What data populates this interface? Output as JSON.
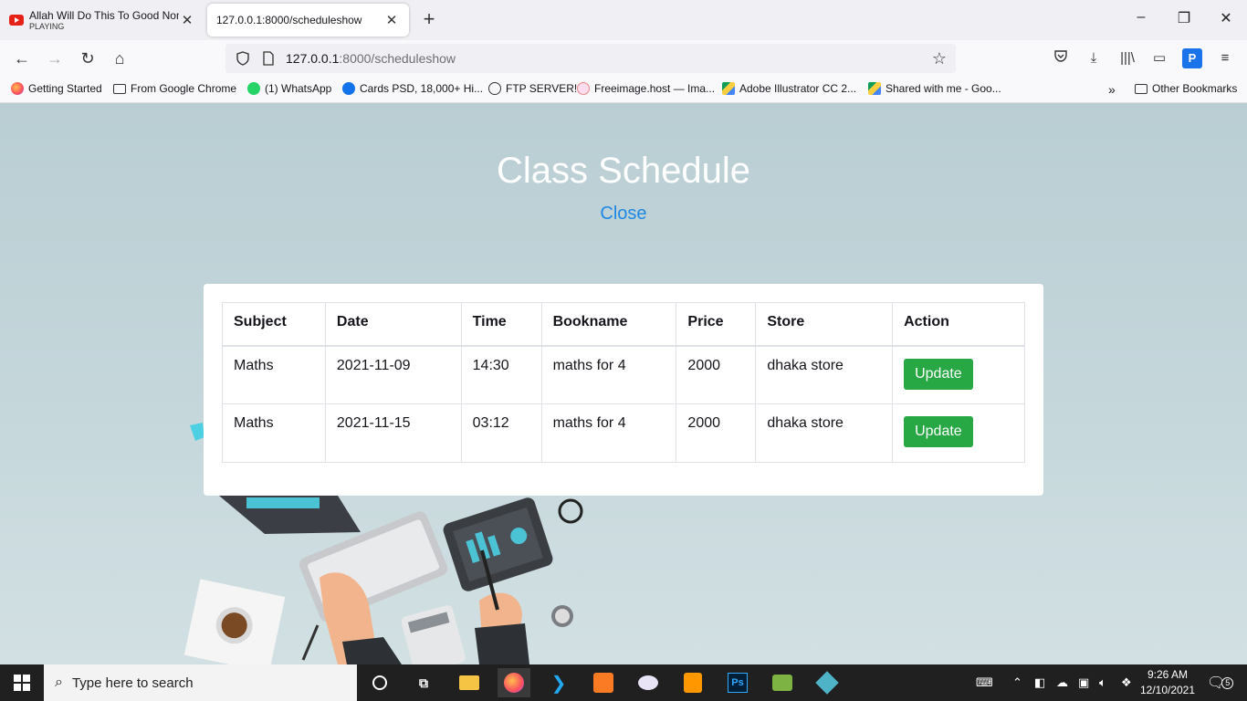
{
  "browser": {
    "tabs": [
      {
        "title": "Allah Will Do This To Good Non",
        "subtitle": "PLAYING",
        "active": false
      },
      {
        "title": "127.0.0.1:8000/scheduleshow",
        "active": true
      }
    ],
    "url_host": "127.0.0.1",
    "url_rest": ":8000/scheduleshow",
    "bookmarks": [
      {
        "label": "Getting Started",
        "icon": "firefox-icon"
      },
      {
        "label": "From Google Chrome",
        "icon": "folder-icon"
      },
      {
        "label": "(1) WhatsApp",
        "icon": "whatsapp-icon"
      },
      {
        "label": "Cards PSD, 18,000+ Hi...",
        "icon": "freepik-icon"
      },
      {
        "label": "FTP SERVER!",
        "icon": "globe-icon"
      },
      {
        "label": "Freeimage.host — Ima...",
        "icon": "freeimage-icon"
      },
      {
        "label": "Adobe Illustrator CC 2...",
        "icon": "google-drive-icon"
      },
      {
        "label": "Shared with me - Goo...",
        "icon": "google-drive-icon"
      }
    ],
    "other_bookmarks": "Other Bookmarks"
  },
  "page": {
    "title": "Class Schedule",
    "close_label": "Close",
    "table": {
      "headers": [
        "Subject",
        "Date",
        "Time",
        "Bookname",
        "Price",
        "Store",
        "Action"
      ],
      "rows": [
        [
          "Maths",
          "2021-11-09",
          "14:30",
          "maths for 4",
          "2000",
          "dhaka store"
        ],
        [
          "Maths",
          "2021-11-15",
          "03:12",
          "maths for 4",
          "2000",
          "dhaka store"
        ]
      ],
      "action_label": "Update"
    }
  },
  "taskbar": {
    "search_placeholder": "Type here to search",
    "time": "9:26 AM",
    "date": "12/10/2021",
    "notification_count": "5"
  },
  "colors": {
    "accent_green": "#28a745",
    "link_blue": "#1e88e5",
    "taskbar": "#202020"
  }
}
